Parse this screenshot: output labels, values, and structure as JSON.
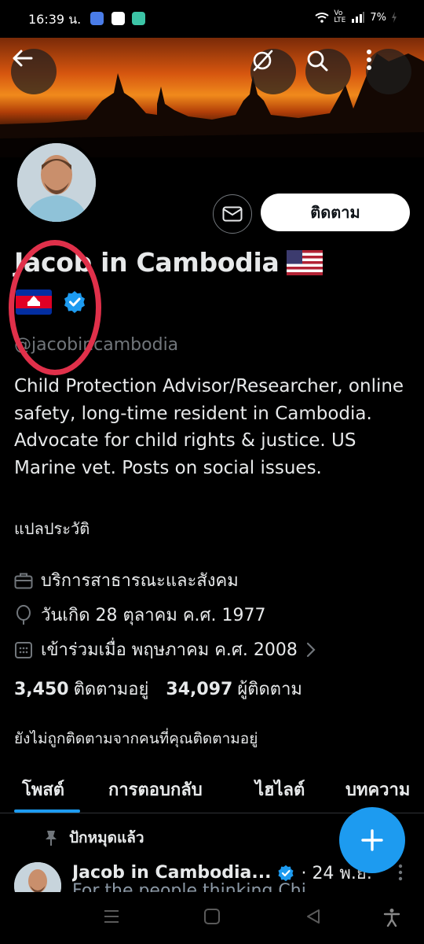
{
  "status_bar": {
    "time": "16:39 น.",
    "network_label": "Vo LTE",
    "battery": "7%"
  },
  "header": {
    "back_icon": "arrow-left-icon",
    "grok_icon": "grok-slash-icon",
    "search_icon": "search-icon",
    "more_icon": "more-vertical-icon"
  },
  "profile": {
    "name": "Jacob in Cambodia",
    "name_emoji": "🇺🇸",
    "flag_emoji": "🇰🇭",
    "verified_color": "#1d9bf0",
    "handle": "@jacobincambodia",
    "bio": "Child Protection Advisor/Researcher, online safety, long-time resident in Cambodia. Advocate for child rights & justice. US Marine vet. Posts on social issues.",
    "translate_label": "แปลประวัติ",
    "follow_label": "ติดตาม",
    "category": "บริการสาธารณะและสังคม",
    "birthday": "วันเกิด 28 ตุลาคม ค.ศ. 1977",
    "joined": "เข้าร่วมเมื่อ พฤษภาคม ค.ศ. 2008",
    "following_count": "3,450",
    "following_label": "ติดตามอยู่",
    "followers_count": "34,097",
    "followers_label": "ผู้ติดตาม",
    "not_followed_note": "ยังไม่ถูกติดตามจากคนที่คุณติดตามอยู่"
  },
  "tabs": [
    {
      "label": "โพสต์",
      "active": true
    },
    {
      "label": "การตอบกลับ",
      "active": false
    },
    {
      "label": "ไฮไลต์",
      "active": false
    },
    {
      "label": "บทความ",
      "active": false
    }
  ],
  "post": {
    "pinned_label": "ปักหมุดแล้ว",
    "author": "Jacob in Cambodia...",
    "date": "· 24 พ.ย.",
    "text_preview": "For the people thinking Chi..."
  },
  "colors": {
    "accent": "#1d9bf0",
    "annotation": "#e0304a"
  }
}
